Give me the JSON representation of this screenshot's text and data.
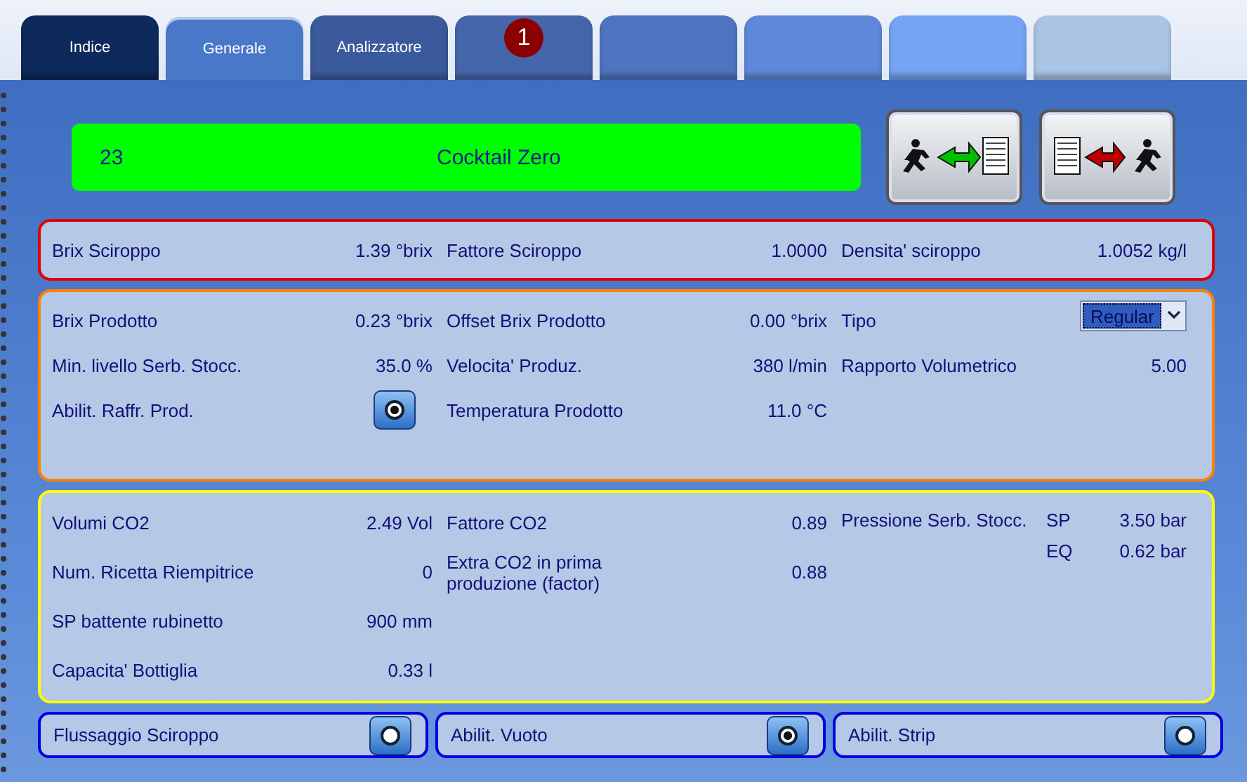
{
  "tabs": [
    {
      "label": "Indice",
      "selected": false,
      "color": "#0e2a5c"
    },
    {
      "label": "Generale",
      "selected": true,
      "color": "#4a78c8"
    },
    {
      "label": "Analizzatore",
      "selected": false,
      "color": "#3b5a9c"
    },
    {
      "badge": "1",
      "selected": false,
      "color": "#4566ab"
    },
    {
      "selected": false,
      "color": "#4f74c0"
    },
    {
      "selected": false,
      "color": "#5f88d8"
    },
    {
      "selected": false,
      "color": "#76a3f2"
    },
    {
      "selected": false,
      "color": "#a9c4e4"
    }
  ],
  "recipe": {
    "number": "23",
    "name": "Cocktail Zero"
  },
  "actions": [
    {
      "kind": "load"
    },
    {
      "kind": "save"
    }
  ],
  "sections": [
    {
      "color": "#e00000",
      "columns": [
        [
          {
            "kind": "value",
            "label": "Brix Sciroppo",
            "value": "1.39 °brix"
          }
        ],
        [
          {
            "kind": "value",
            "label": "Fattore Sciroppo",
            "value": "1.0000"
          }
        ],
        [
          {
            "kind": "value",
            "label": "Densita' sciroppo",
            "value": "1.0052 kg/l"
          }
        ]
      ]
    },
    {
      "color": "#ff8000",
      "columns": [
        [
          {
            "kind": "value",
            "label": "Brix Prodotto",
            "value": "0.23 °brix"
          },
          {
            "kind": "value",
            "label": "Min. livello Serb. Stocc.",
            "value": "35.0 %"
          },
          {
            "kind": "toggle",
            "label": "Abilit. Raffr. Prod.",
            "on": true
          }
        ],
        [
          {
            "kind": "value",
            "label": "Offset Brix Prodotto",
            "value": "0.00 °brix"
          },
          {
            "kind": "value",
            "label": "Velocita' Produz.",
            "value": "380 l/min"
          },
          {
            "kind": "value",
            "label": "Temperatura Prodotto",
            "value": "11.0 °C"
          }
        ],
        [
          {
            "kind": "select",
            "label": "Tipo",
            "value": "Regular"
          },
          {
            "kind": "value",
            "label": "Rapporto Volumetrico",
            "value": "5.00"
          }
        ]
      ]
    },
    {
      "color": "#ffff00",
      "columns": [
        [
          {
            "kind": "value",
            "label": "Volumi CO2",
            "value": "2.49 Vol"
          },
          {
            "kind": "value",
            "label": "Num. Ricetta Riempitrice",
            "value": "0"
          },
          {
            "kind": "value",
            "label": "SP battente rubinetto",
            "value": "900 mm"
          },
          {
            "kind": "value",
            "label": "Capacita' Bottiglia",
            "value": "0.33 l"
          }
        ],
        [
          {
            "kind": "value",
            "label": "Fattore CO2",
            "value": "0.89"
          },
          {
            "kind": "value",
            "label": "Extra CO2 in prima produzione (factor)",
            "value": "0.88"
          }
        ],
        [
          {
            "kind": "pairs",
            "label": "Pressione Serb. Stocc.",
            "pairs": [
              {
                "key": "SP",
                "value": "3.50 bar"
              },
              {
                "key": "EQ",
                "value": "0.62 bar"
              }
            ]
          }
        ]
      ]
    }
  ],
  "switches": [
    {
      "label": "Flussaggio Sciroppo",
      "on": false
    },
    {
      "label": "Abilit. Vuoto",
      "on": true
    },
    {
      "label": "Abilit. Strip",
      "on": false
    }
  ]
}
